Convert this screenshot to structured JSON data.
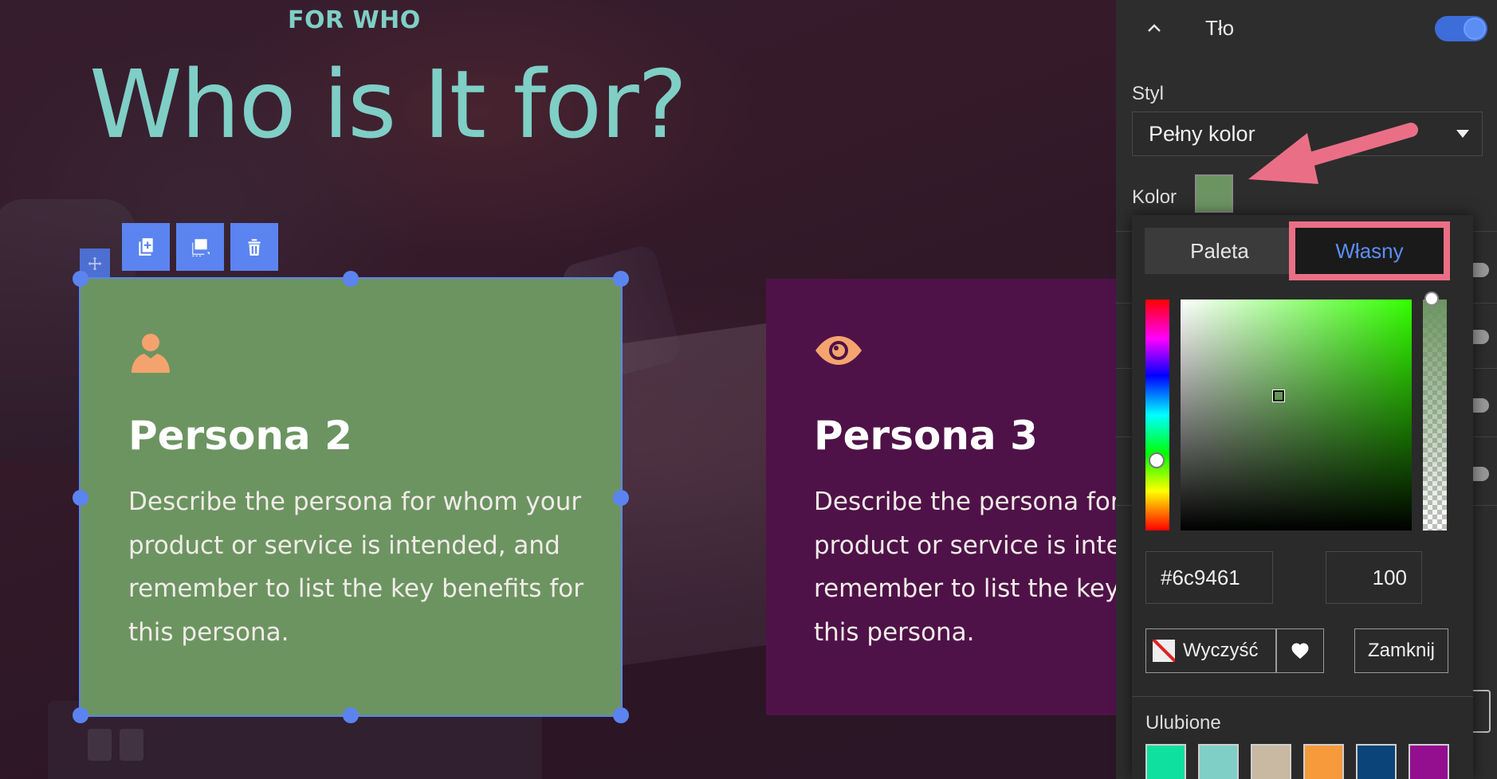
{
  "canvas": {
    "kicker": "FOR WHO",
    "headline": "Who is It for?",
    "element_toolbar": {
      "icons": [
        "duplicate-icon",
        "layer-settings-icon",
        "trash-icon"
      ]
    },
    "cards": [
      {
        "title": "Persona 2",
        "icon": "person-icon",
        "description": [
          "Describe the persona for whom your",
          "product or service is intended, and",
          "remember to list the key benefits for",
          "this persona."
        ],
        "background": "#6c9461",
        "selected": true
      },
      {
        "title": "Persona 3",
        "icon": "eye-icon",
        "description": [
          "Describe the persona for whom your",
          "product or service is intended, and",
          "remember to list the key benefits for",
          "this persona."
        ],
        "background": "#4f1248",
        "selected": false
      }
    ],
    "accent": "#7fcfc6",
    "icon_color": "#f5a36e"
  },
  "panel": {
    "section_title": "Tło",
    "section_enabled": true,
    "style_label": "Styl",
    "style_value": "Pełny kolor",
    "color_label": "Kolor",
    "color_value": "#6c9461",
    "picker": {
      "tabs": [
        "Paleta",
        "Własny"
      ],
      "active_tab": "Własny",
      "hex": "#6c9461",
      "opacity": "100",
      "clear_label": "Wyczyść",
      "close_label": "Zamknij",
      "favorites_label": "Ulubione",
      "favorites": [
        "#0fe0a0",
        "#7fcfc6",
        "#c9b8a2",
        "#f79a3c",
        "#0b4478",
        "#940f90"
      ]
    },
    "accent": "#5b8ef5"
  },
  "annotation": {
    "color": "#ea6f86"
  }
}
